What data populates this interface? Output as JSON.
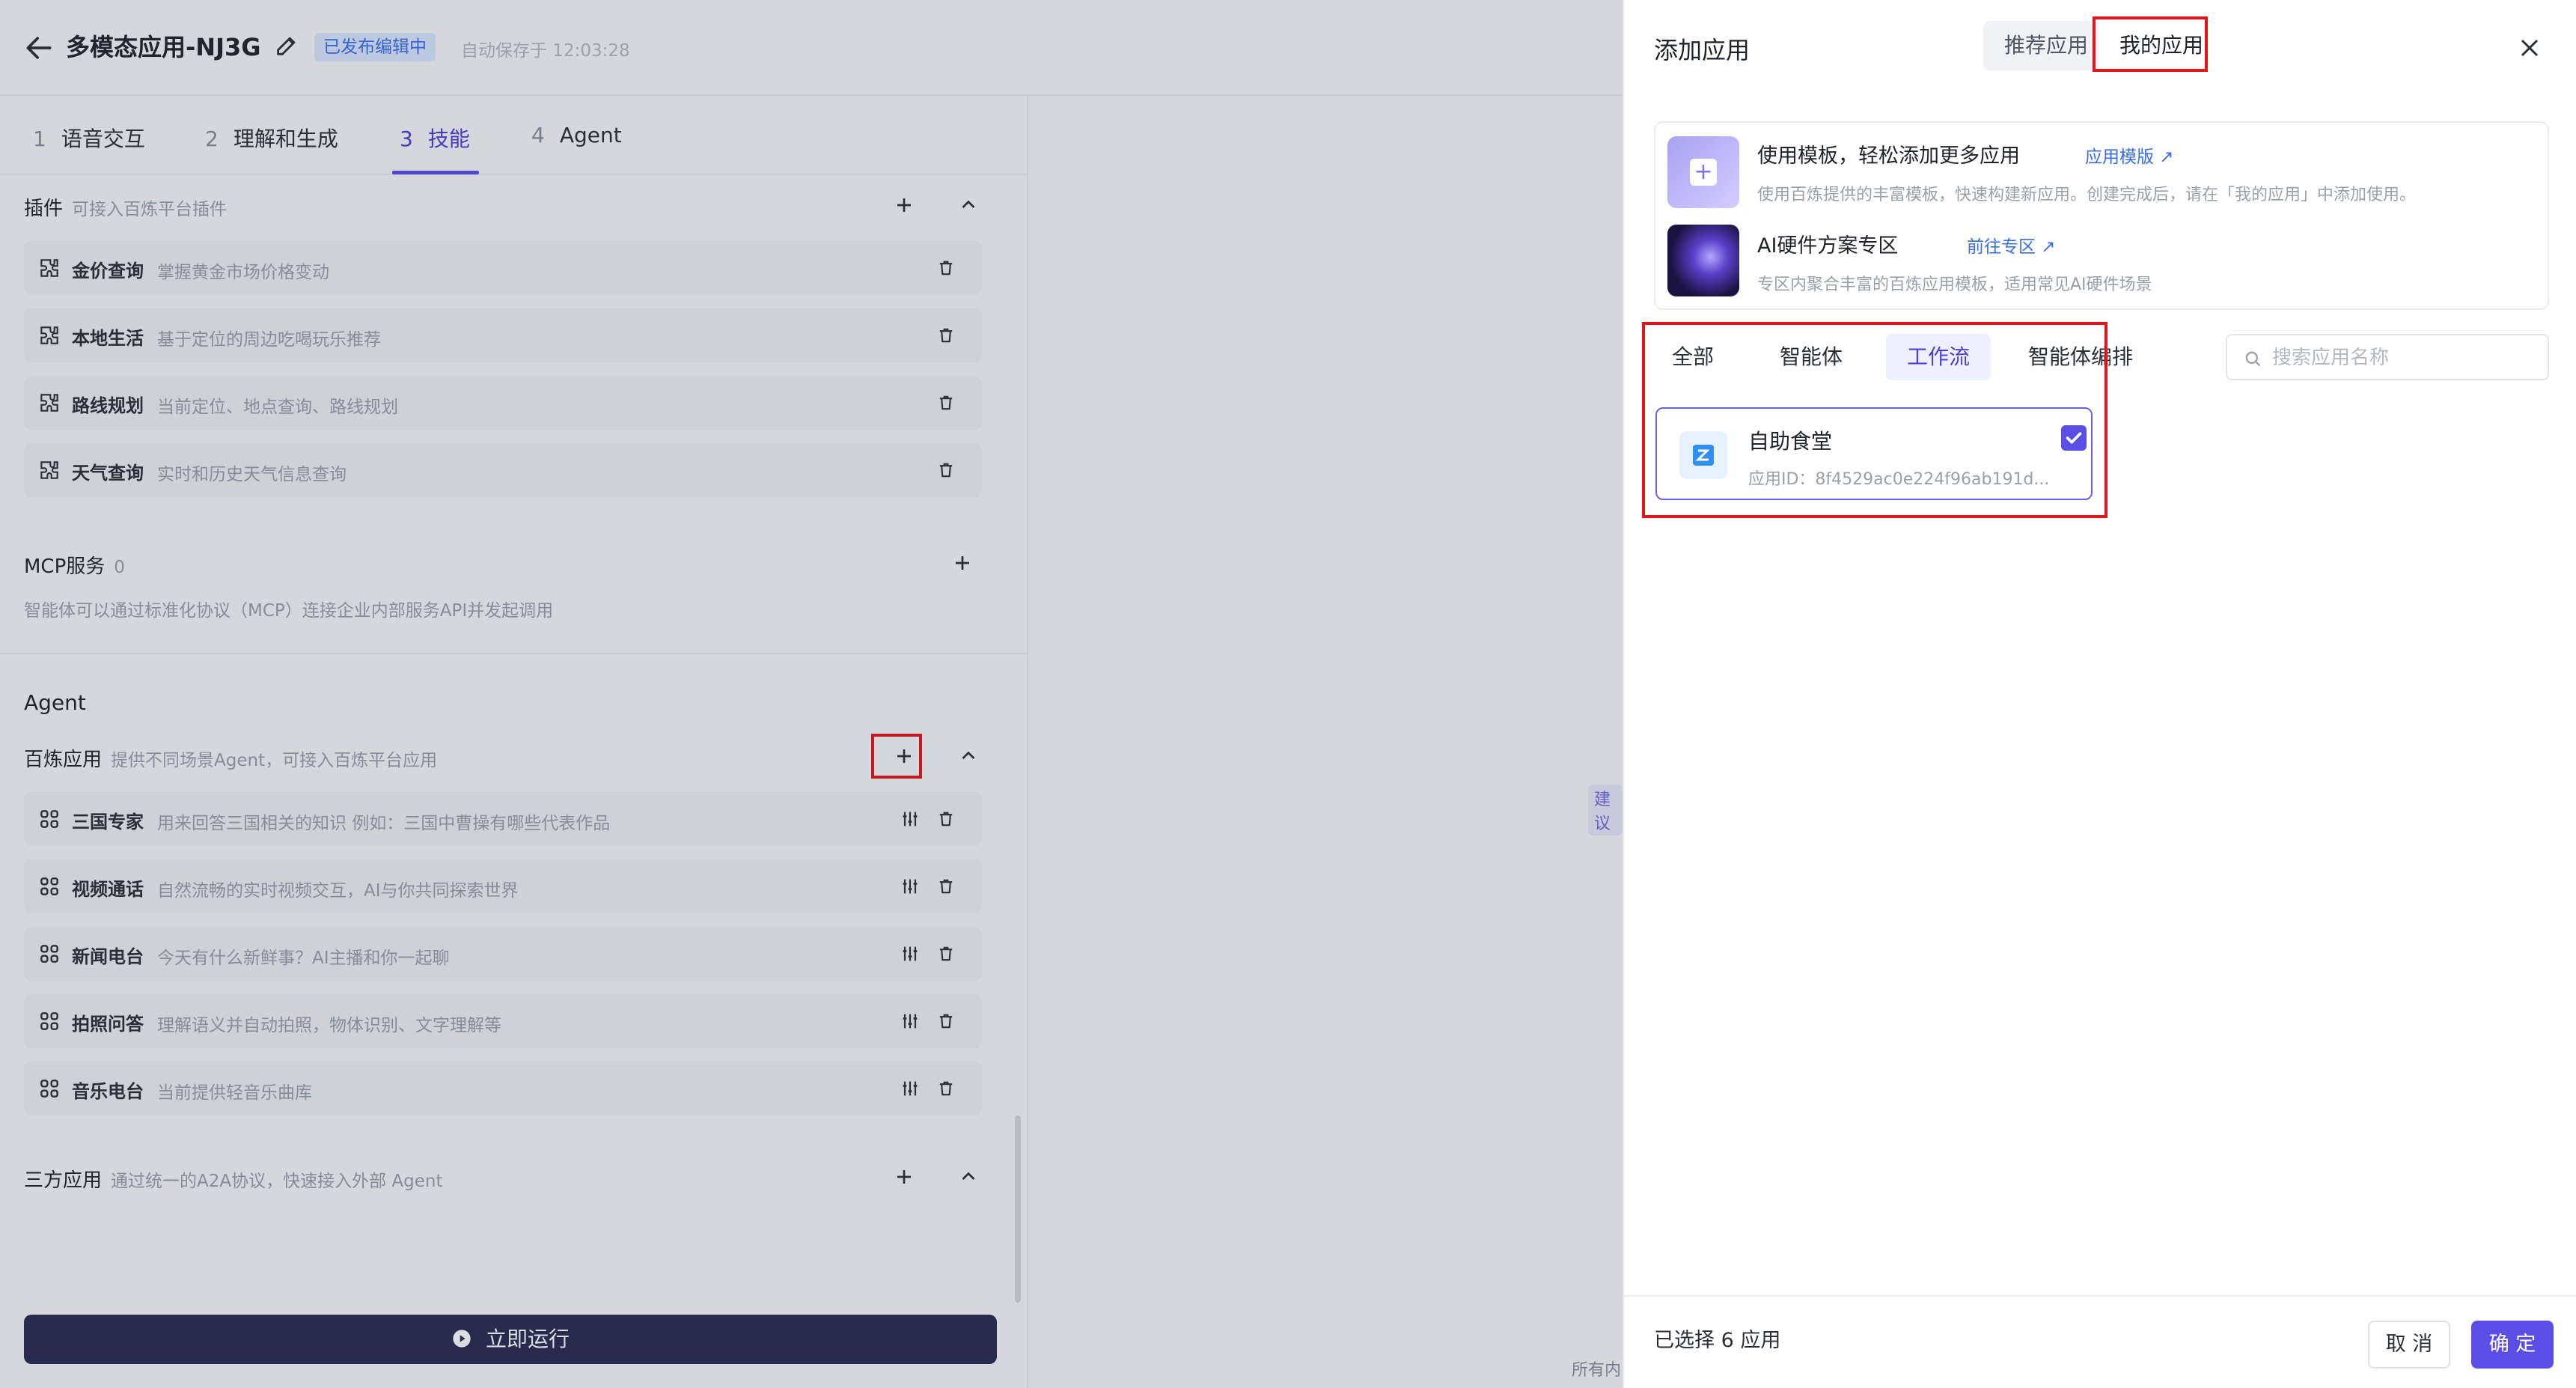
{
  "header": {
    "title": "多模态应用-NJ3G",
    "status_badge": "已发布编辑中",
    "autosave": "自动保存于 12:03:28"
  },
  "steps": [
    {
      "num": "1",
      "label": "语音交互"
    },
    {
      "num": "2",
      "label": "理解和生成"
    },
    {
      "num": "3",
      "label": "技能"
    },
    {
      "num": "4",
      "label": "Agent"
    }
  ],
  "plugins": {
    "title": "插件",
    "subtitle": "可接入百炼平台插件",
    "items": [
      {
        "name": "金价查询",
        "desc": "掌握黄金市场价格变动"
      },
      {
        "name": "本地生活",
        "desc": "基于定位的周边吃喝玩乐推荐"
      },
      {
        "name": "路线规划",
        "desc": "当前定位、地点查询、路线规划"
      },
      {
        "name": "天气查询",
        "desc": "实时和历史天气信息查询"
      }
    ]
  },
  "mcp": {
    "title": "MCP服务",
    "count": "0",
    "desc": "智能体可以通过标准化协议（MCP）连接企业内部服务API并发起调用"
  },
  "agent_section": {
    "label": "Agent",
    "bailian": {
      "title": "百炼应用",
      "subtitle": "提供不同场景Agent，可接入百炼平台应用",
      "items": [
        {
          "name": "三国专家",
          "desc": "用来回答三国相关的知识 例如：三国中曹操有哪些代表作品"
        },
        {
          "name": "视频通话",
          "desc": "自然流畅的实时视频交互，AI与你共同探索世界"
        },
        {
          "name": "新闻电台",
          "desc": "今天有什么新鲜事？AI主播和你一起聊"
        },
        {
          "name": "拍照问答",
          "desc": "理解语义并自动拍照，物体识别、文字理解等"
        },
        {
          "name": "音乐电台",
          "desc": "当前提供轻音乐曲库"
        }
      ]
    },
    "third_party": {
      "title": "三方应用",
      "subtitle": "通过统一的A2A协议，快速接入外部 Agent"
    }
  },
  "run_button": "立即运行",
  "mid_fragments": {
    "a": "建议",
    "b": "所有内"
  },
  "drawer": {
    "title": "添加应用",
    "tabs": {
      "recommended": "推荐应用",
      "mine": "我的应用"
    },
    "promo": {
      "template_title": "使用模板，轻松添加更多应用",
      "template_link": "应用模版",
      "template_desc": "使用百炼提供的丰富模板，快速构建新应用。创建完成后，请在「我的应用」中添加使用。",
      "hardware_title": "AI硬件方案专区",
      "hardware_link": "前往专区",
      "hardware_desc": "专区内聚合丰富的百炼应用模板，适用常见AI硬件场景"
    },
    "filters": [
      "全部",
      "智能体",
      "工作流",
      "智能体编排"
    ],
    "search": {
      "placeholder": "搜索应用名称",
      "value": ""
    },
    "card": {
      "name": "自助食堂",
      "id": "应用ID：8f4529ac0e224f96ab191d..."
    },
    "footer": {
      "selected": "已选择 6 应用",
      "cancel": "取 消",
      "confirm": "确 定"
    }
  },
  "colors": {
    "accent": "#5b4ee6",
    "highlight_box": "#e0161b",
    "run_button": "#2a2c52"
  }
}
